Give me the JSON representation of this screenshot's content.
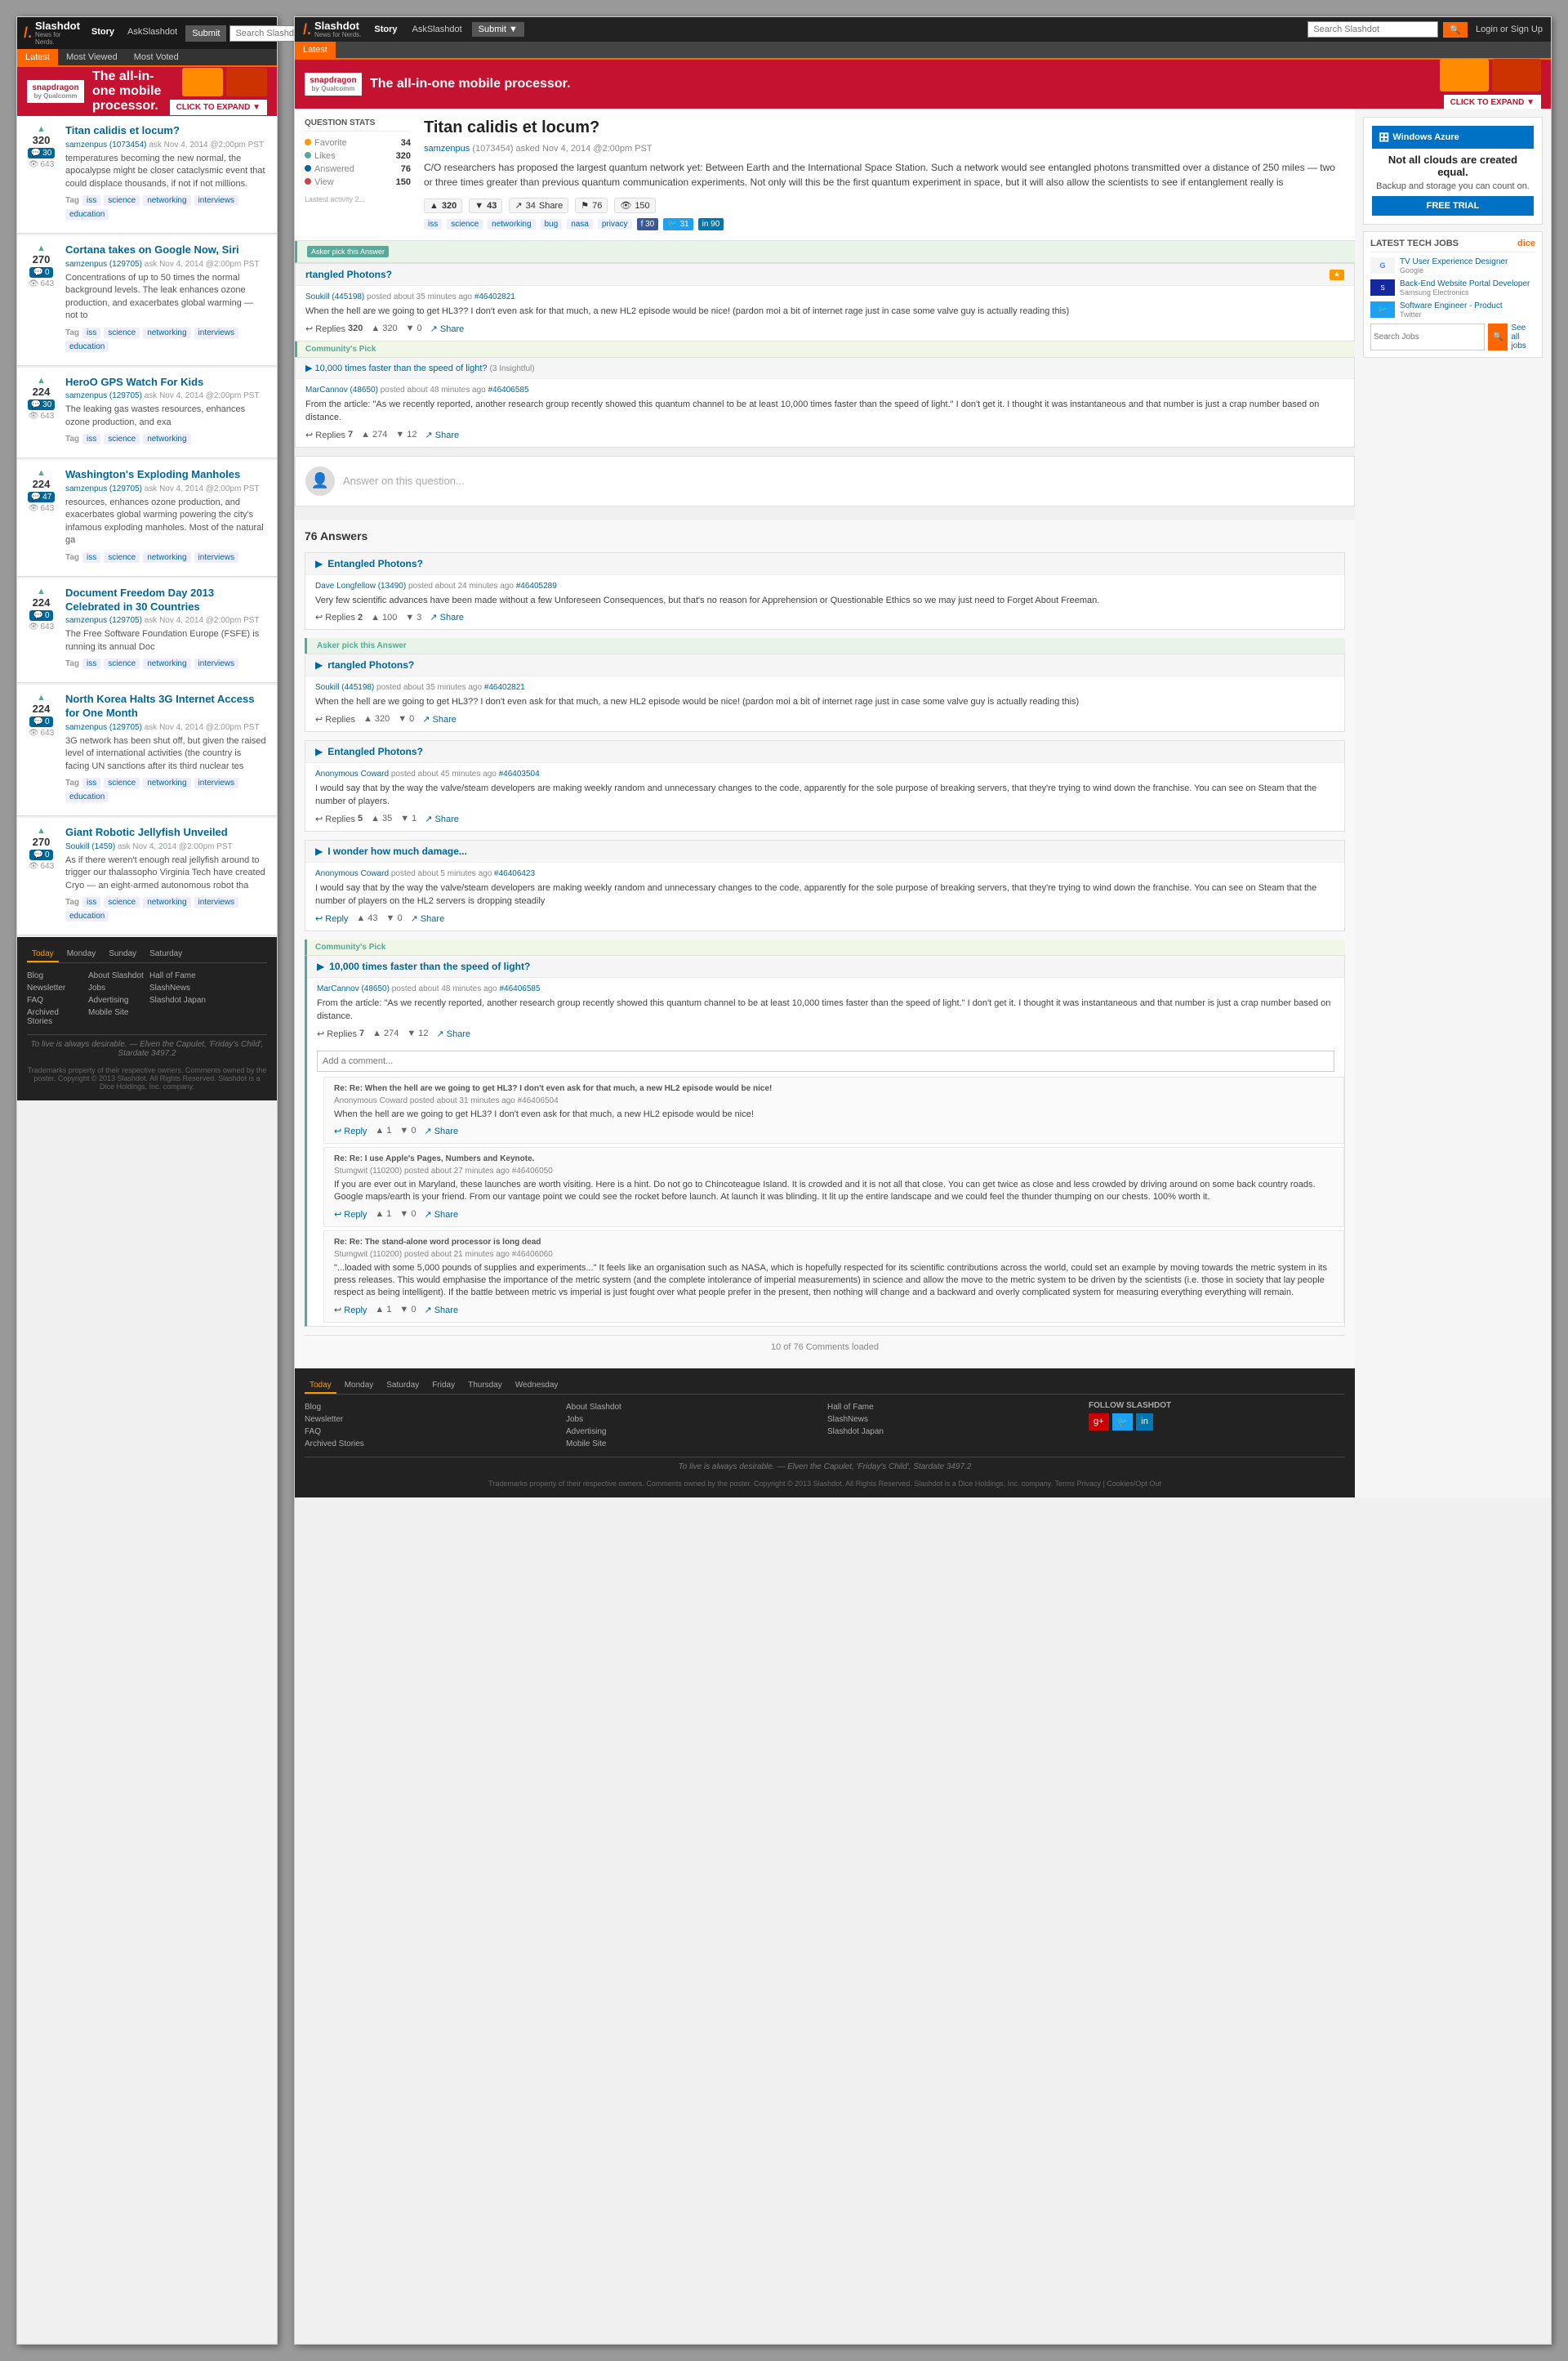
{
  "site": {
    "name": "Slashdot",
    "slash": "/.",
    "tagline": "News for Nerds.",
    "logo_text": "Slashdot"
  },
  "header": {
    "nav": [
      "Story",
      "AskSlashdot",
      "Submit",
      "Search Slashdot"
    ],
    "submit_label": "Submit",
    "search_placeholder": "Search Slashdot",
    "login_label": "Login or Sign Up",
    "tabs": [
      "Latest",
      "Most Viewed",
      "Most Voted"
    ]
  },
  "ad": {
    "brand": "snapdragon",
    "brand_sub": "by Qualcomm",
    "text": "The all-in-one mobile processor.",
    "cta": "CLICK TO EXPAND ▼"
  },
  "articles": [
    {
      "votes": 320,
      "comments": 30,
      "views": 643,
      "title": "Titan calidis et locum?",
      "author": "samzenpus (1073454)",
      "date": "ask Nov 4, 2014 @2:00pm PST",
      "excerpt": "temperatures becoming the new normal, the apocalypse might be closer cataclysmic event that could displace thousands, if not if not millions.",
      "tags": [
        "iss",
        "science",
        "networking",
        "interviews",
        "education"
      ]
    },
    {
      "votes": 270,
      "comments": 0,
      "views": 643,
      "title": "Cortana takes on Google Now, Siri",
      "author": "samzenpus (129705)",
      "date": "ask Nov 4, 2014 @2:00pm PST",
      "excerpt": "Concentrations of up to 50 times the normal background levels. The leak enhances ozone production, and exacerbates global warming — not to",
      "tags": [
        "iss",
        "science",
        "networking",
        "interviews",
        "education"
      ]
    },
    {
      "votes": 224,
      "comments": 30,
      "views": 643,
      "title": "HeroO GPS Watch For Kids",
      "author": "samzenpus (129705)",
      "date": "ask Nov 4, 2014 @2:00pm PST",
      "excerpt": "The leaking gas wastes resources, enhances ozone production, and exa",
      "tags": [
        "iss",
        "science",
        "networking"
      ]
    },
    {
      "votes": 224,
      "comments": 47,
      "views": 643,
      "title": "Washington's Exploding Manholes",
      "author": "samzenpus (129705)",
      "date": "ask Nov 4, 2014 @2:00pm PST",
      "excerpt": "resources, enhances ozone production, and exacerbates global warming powering the city's infamous exploding manholes. Most of the natural ga",
      "tags": [
        "iss",
        "science",
        "networking",
        "interviews"
      ]
    },
    {
      "votes": 224,
      "comments": 0,
      "views": 643,
      "title": "Document Freedom Day 2013 Celebrated in 30 Countries",
      "author": "samzenpus (129705)",
      "date": "ask Nov 4, 2014 @2:00pm PST",
      "excerpt": "The Free Software Foundation Europe (FSFE) is running its annual Doc",
      "tags": [
        "iss",
        "science",
        "networking",
        "interviews"
      ]
    },
    {
      "votes": 224,
      "comments": 0,
      "views": 643,
      "title": "North Korea Halts 3G Internet Access for One Month",
      "author": "samzenpus (129705)",
      "date": "ask Nov 4, 2014 @2:00pm PST",
      "excerpt": "3G network has been shut off, but given the raised level of international activities (the country is facing UN sanctions after its third nuclear tes",
      "tags": [
        "iss",
        "science",
        "networking",
        "interviews",
        "education"
      ]
    },
    {
      "votes": 270,
      "comments": 0,
      "views": 643,
      "title": "Giant Robotic Jellyfish Unveiled",
      "author": "Soukill (1459)",
      "date": "ask Nov 4, 2014 @2:00pm PST",
      "excerpt": "As if there weren't enough real jellyfish around to trigger our thalassopho Virginia Tech have created Cryo — an eight-armed autonomous robot tha",
      "tags": [
        "iss",
        "science",
        "networking",
        "interviews",
        "education"
      ]
    }
  ],
  "footer": {
    "days": [
      "Today",
      "Monday",
      "Sunday",
      "Saturday"
    ],
    "links_col1": [
      "Blog",
      "Newsletter",
      "FAQ",
      "Archived Stories"
    ],
    "links_col2": [
      "About Slashdot",
      "Jobs",
      "Advertising",
      "Mobile Site"
    ],
    "links_col3": [
      "Hall of Fame",
      "SlashNews",
      "Slashdot Japan"
    ],
    "tagline": "To live is always desirable. — Elven the Capulet, 'Friday's Child', Stardate 3497.2",
    "copyright": "Trademarks property of their respective owners. Comments owned by the poster. Copyright © 2013 Slashdot. All Rights Reserved. Slashdot is a Dice Holdings, Inc. company."
  },
  "question": {
    "title": "Titan calidis et locum?",
    "author_name": "samzenpus",
    "author_id": "1073454",
    "date": "Nov 4, 2014 @2:00pm PST",
    "stats": {
      "favorite": 34,
      "likes": 320,
      "answered": 76,
      "view": 150
    },
    "body": "C/O researchers has proposed the largest quantum network yet: Between Earth and the International Space Station. Such a network would see entangled photons transmitted over a distance of 250 miles — two or three times greater than previous quantum communication experiments. Not only will this be the first quantum experiment in space, but it will also allow the scientists to see if entanglement really is",
    "votes_up": 320,
    "votes_down": 43,
    "shares": 34,
    "flag": 76,
    "views": 150,
    "tags": [
      "iss",
      "science",
      "networking",
      "bug",
      "nasa",
      "privacy"
    ],
    "social": [
      "Facebook 30",
      "Twitter 31",
      "LinkedIn 90"
    ]
  },
  "answer_form": {
    "placeholder": "Answer on this question..."
  },
  "answers_count": "76 Answers",
  "answers": [
    {
      "id": 1,
      "title": "Entangled Photons?",
      "author": "Dave Longfellow (13490)",
      "time_ago": "posted about 24 minutes ago",
      "link_id": "#46405289",
      "text": "Very few scientific advances have been made without a few Unforeseen Consequences, but that's no reason for Apprehension or Questionable Ethics so we may just need to Forget About Freeman.",
      "replies": 2,
      "thumbs_up": 100,
      "thumbs_down": 3,
      "asker_pick": false,
      "community_pick": false
    },
    {
      "id": 2,
      "title": "rtangled Photons?",
      "author": "Soukill (445198)",
      "time_ago": "posted about 35 minutes ago",
      "link_id": "#46402821",
      "text": "When the hell are we going to get HL3?? I don't even ask for that much, a new HL2 episode would be nice! (pardon moi a bit of internet rage just in case some valve guy is actually reading this)",
      "replies_label": "Replies",
      "thumbs_up": 320,
      "thumbs_down": 0,
      "asker_pick": true,
      "community_pick": false
    },
    {
      "id": 3,
      "title": "Entangled Photons?",
      "author": "Anonymous Coward",
      "time_ago": "posted about 45 minutes ago",
      "link_id": "#46403504",
      "text": "I would say that by the way the valve/steam developers are making weekly random and unnecessary changes to the code, apparently for the sole purpose of breaking servers, that they're trying to wind down the franchise. You can see on Steam that the number of players.",
      "replies": 5,
      "thumbs_up": 35,
      "thumbs_down": 1,
      "asker_pick": false,
      "community_pick": false
    },
    {
      "id": 4,
      "title": "I wonder how much damage...",
      "author": "Anonymous Coward",
      "time_ago": "posted about 5 minutes ago",
      "link_id": "#46406423",
      "text": "I would say that by the way the valve/steam developers are making weekly random and unnecessary changes to the code, apparently for the sole purpose of breaking servers, that they're trying to wind down the franchise. You can see on Steam that the number of players on the HL2 servers is dropping steadily",
      "replies": null,
      "thumbs_up": 43,
      "thumbs_down": 0,
      "asker_pick": false,
      "community_pick": false
    },
    {
      "id": 5,
      "title": "10,000 times faster than the speed of light?",
      "author": "MarCannov (48650)",
      "time_ago": "posted about 48 minutes ago",
      "link_id": "#46406585",
      "text": "From the article: \"As we recently reported, another research group recently showed this quantum channel to be at least 10,000 times faster than the speed of light.\" I don't get it. I thought it was instantaneous and that number is just a crap number based on distance.",
      "replies": 7,
      "thumbs_up": 274,
      "thumbs_down": 12,
      "asker_pick": false,
      "community_pick": true,
      "nested_comments": [
        {
          "type": "re",
          "subject": "Re: When the hell are we going to get HL3? I don't even ask for that much, a new HL2 episode would be nice!",
          "author": "Anonymous Coward",
          "time_ago": "posted about 31 minutes ago",
          "link_id": "#46406504",
          "text": "When the hell are we going to get HL3? I don't even ask for that much, a new HL2 episode would be nice!",
          "thumbs_up": 1,
          "thumbs_down": 0
        },
        {
          "type": "re",
          "subject": "Re: I use Apple's Pages, Numbers and Keynote.",
          "author": "Stumgwit (110200)",
          "time_ago": "posted about 27 minutes ago",
          "link_id": "#46406050",
          "text": "If you are ever out in Maryland, these launches are worth visiting. Here is a hint. Do not go to Chincoteague Island. It is crowded and it is not all that close. You can get twice as close and less crowded by driving around on some back country roads. Google maps/earth is your friend. From our vantage point we could see the rocket before launch. At launch it was blinding. It lit up the entire landscape and we could feel the thunder thumping on our chests. 100% worth it.",
          "thumbs_up": 1,
          "thumbs_down": 0
        },
        {
          "type": "re",
          "subject": "Re: The stand-alone word processor is long dead",
          "author": "Stumgwit (110200)",
          "time_ago": "posted about 21 minutes ago",
          "link_id": "#46406060",
          "text": "\"...loaded with some 5,000 pounds of supplies and experiments...\" It feels like an organisation such as NASA, which is hopefully respected for its scientific contributions across the world, could set an example by moving towards the metric system in its press releases. This would emphasise the importance of the metric system (and the complete intolerance of imperial measurements) in science and allow the move to the metric system to be driven by the scientists (i.e. those in society that lay people respect as being intelligent). If the battle between metric vs imperial is just fought over what people prefer in the present, then nothing will change and a backward and overly complicated system for measuring everything everything will remain.",
          "thumbs_up": 1,
          "thumbs_down": 0
        }
      ]
    }
  ],
  "load_more": "10 of 76 Comments loaded",
  "right_footer": {
    "days": [
      "Today",
      "Monday",
      "Saturday",
      "Friday",
      "Thursday",
      "Wednesday"
    ],
    "links_col1": [
      "Blog",
      "Newsletter",
      "FAQ",
      "Archived Stories"
    ],
    "links_col2": [
      "About Slashdot",
      "Jobs",
      "Advertising",
      "Mobile Site"
    ],
    "links_col3": [
      "Hall of Fame",
      "SlashNews",
      "Slashdot Japan"
    ],
    "tagline": "To live is always desirable. — Elven the Capulet, 'Friday's Child', Stardate 3497.2",
    "copyright": "Trademarks property of their respective owners. Comments owned by the poster. Copyright © 2013 Slashdot. All Rights Reserved. Slashdot is a Dice Holdings, Inc. company. Terms Privacy | Cookies/Opt Out"
  },
  "azure_ad": {
    "logo": "Windows Azure",
    "headline": "Not all clouds are created equal.",
    "subtext": "Backup and storage you can count on.",
    "cta": "FREE TRIAL"
  },
  "tech_jobs": {
    "title": "LATEST TECH JOBS",
    "powered_by": "dice",
    "jobs": [
      {
        "company": "Google",
        "title": "TV User Experience Designer",
        "company_name": "Google"
      },
      {
        "company": "Samsung",
        "title": "Back-End Website Portal Developer",
        "company_name": "Samsung Electronics"
      },
      {
        "company": "Twitter",
        "title": "Software Engineer - Product",
        "company_name": "Twitter"
      }
    ],
    "search_placeholder": "Search Jobs",
    "see_all": "See all jobs"
  }
}
